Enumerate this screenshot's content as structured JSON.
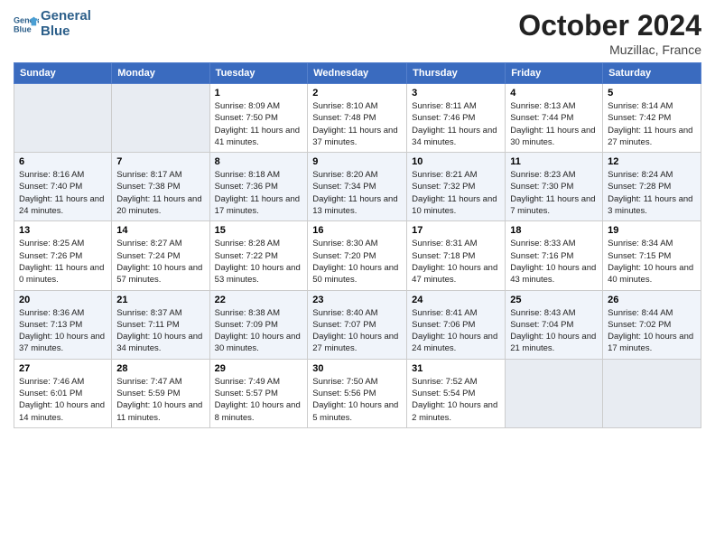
{
  "header": {
    "logo_line1": "General",
    "logo_line2": "Blue",
    "month": "October 2024",
    "location": "Muzillac, France"
  },
  "columns": [
    "Sunday",
    "Monday",
    "Tuesday",
    "Wednesday",
    "Thursday",
    "Friday",
    "Saturday"
  ],
  "weeks": [
    [
      {
        "day": "",
        "info": ""
      },
      {
        "day": "",
        "info": ""
      },
      {
        "day": "1",
        "info": "Sunrise: 8:09 AM\nSunset: 7:50 PM\nDaylight: 11 hours and 41 minutes."
      },
      {
        "day": "2",
        "info": "Sunrise: 8:10 AM\nSunset: 7:48 PM\nDaylight: 11 hours and 37 minutes."
      },
      {
        "day": "3",
        "info": "Sunrise: 8:11 AM\nSunset: 7:46 PM\nDaylight: 11 hours and 34 minutes."
      },
      {
        "day": "4",
        "info": "Sunrise: 8:13 AM\nSunset: 7:44 PM\nDaylight: 11 hours and 30 minutes."
      },
      {
        "day": "5",
        "info": "Sunrise: 8:14 AM\nSunset: 7:42 PM\nDaylight: 11 hours and 27 minutes."
      }
    ],
    [
      {
        "day": "6",
        "info": "Sunrise: 8:16 AM\nSunset: 7:40 PM\nDaylight: 11 hours and 24 minutes."
      },
      {
        "day": "7",
        "info": "Sunrise: 8:17 AM\nSunset: 7:38 PM\nDaylight: 11 hours and 20 minutes."
      },
      {
        "day": "8",
        "info": "Sunrise: 8:18 AM\nSunset: 7:36 PM\nDaylight: 11 hours and 17 minutes."
      },
      {
        "day": "9",
        "info": "Sunrise: 8:20 AM\nSunset: 7:34 PM\nDaylight: 11 hours and 13 minutes."
      },
      {
        "day": "10",
        "info": "Sunrise: 8:21 AM\nSunset: 7:32 PM\nDaylight: 11 hours and 10 minutes."
      },
      {
        "day": "11",
        "info": "Sunrise: 8:23 AM\nSunset: 7:30 PM\nDaylight: 11 hours and 7 minutes."
      },
      {
        "day": "12",
        "info": "Sunrise: 8:24 AM\nSunset: 7:28 PM\nDaylight: 11 hours and 3 minutes."
      }
    ],
    [
      {
        "day": "13",
        "info": "Sunrise: 8:25 AM\nSunset: 7:26 PM\nDaylight: 11 hours and 0 minutes."
      },
      {
        "day": "14",
        "info": "Sunrise: 8:27 AM\nSunset: 7:24 PM\nDaylight: 10 hours and 57 minutes."
      },
      {
        "day": "15",
        "info": "Sunrise: 8:28 AM\nSunset: 7:22 PM\nDaylight: 10 hours and 53 minutes."
      },
      {
        "day": "16",
        "info": "Sunrise: 8:30 AM\nSunset: 7:20 PM\nDaylight: 10 hours and 50 minutes."
      },
      {
        "day": "17",
        "info": "Sunrise: 8:31 AM\nSunset: 7:18 PM\nDaylight: 10 hours and 47 minutes."
      },
      {
        "day": "18",
        "info": "Sunrise: 8:33 AM\nSunset: 7:16 PM\nDaylight: 10 hours and 43 minutes."
      },
      {
        "day": "19",
        "info": "Sunrise: 8:34 AM\nSunset: 7:15 PM\nDaylight: 10 hours and 40 minutes."
      }
    ],
    [
      {
        "day": "20",
        "info": "Sunrise: 8:36 AM\nSunset: 7:13 PM\nDaylight: 10 hours and 37 minutes."
      },
      {
        "day": "21",
        "info": "Sunrise: 8:37 AM\nSunset: 7:11 PM\nDaylight: 10 hours and 34 minutes."
      },
      {
        "day": "22",
        "info": "Sunrise: 8:38 AM\nSunset: 7:09 PM\nDaylight: 10 hours and 30 minutes."
      },
      {
        "day": "23",
        "info": "Sunrise: 8:40 AM\nSunset: 7:07 PM\nDaylight: 10 hours and 27 minutes."
      },
      {
        "day": "24",
        "info": "Sunrise: 8:41 AM\nSunset: 7:06 PM\nDaylight: 10 hours and 24 minutes."
      },
      {
        "day": "25",
        "info": "Sunrise: 8:43 AM\nSunset: 7:04 PM\nDaylight: 10 hours and 21 minutes."
      },
      {
        "day": "26",
        "info": "Sunrise: 8:44 AM\nSunset: 7:02 PM\nDaylight: 10 hours and 17 minutes."
      }
    ],
    [
      {
        "day": "27",
        "info": "Sunrise: 7:46 AM\nSunset: 6:01 PM\nDaylight: 10 hours and 14 minutes."
      },
      {
        "day": "28",
        "info": "Sunrise: 7:47 AM\nSunset: 5:59 PM\nDaylight: 10 hours and 11 minutes."
      },
      {
        "day": "29",
        "info": "Sunrise: 7:49 AM\nSunset: 5:57 PM\nDaylight: 10 hours and 8 minutes."
      },
      {
        "day": "30",
        "info": "Sunrise: 7:50 AM\nSunset: 5:56 PM\nDaylight: 10 hours and 5 minutes."
      },
      {
        "day": "31",
        "info": "Sunrise: 7:52 AM\nSunset: 5:54 PM\nDaylight: 10 hours and 2 minutes."
      },
      {
        "day": "",
        "info": ""
      },
      {
        "day": "",
        "info": ""
      }
    ]
  ]
}
